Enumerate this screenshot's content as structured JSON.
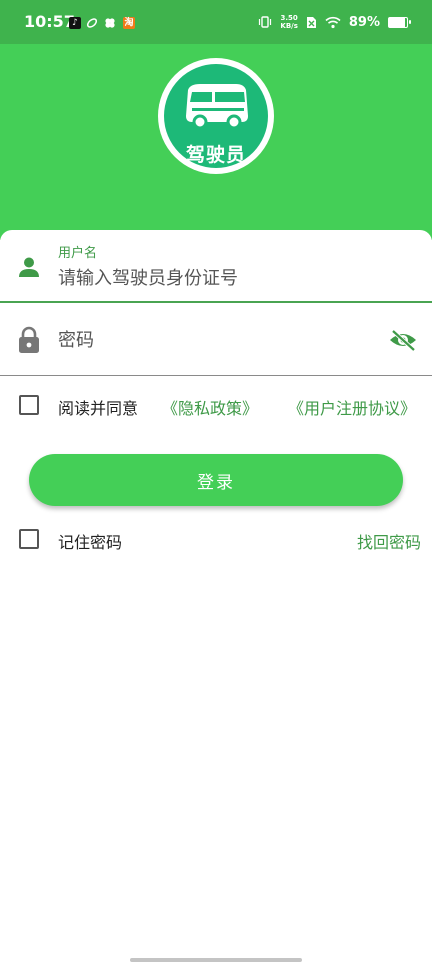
{
  "status_bar": {
    "time": "10:57",
    "net_speed_value": "3.50",
    "net_speed_unit": "KB/s",
    "battery_percent": "89%",
    "battery_level": 0.89
  },
  "header": {
    "logo_text": "驾驶员"
  },
  "form": {
    "username_label": "用户名",
    "username_placeholder": "请输入驾驶员身份证号",
    "password_placeholder": "密码",
    "agree_text": "阅读并同意",
    "privacy_link": "《隐私政策》",
    "user_agreement_link": "《用户注册协议》",
    "login_button": "登录",
    "remember_password": "记住密码",
    "forgot_password": "找回密码"
  },
  "colors": {
    "status_bar": "#3fb34d",
    "header": "#44cf57",
    "accent": "#3f9a48",
    "logo_bg": "#1db978"
  }
}
